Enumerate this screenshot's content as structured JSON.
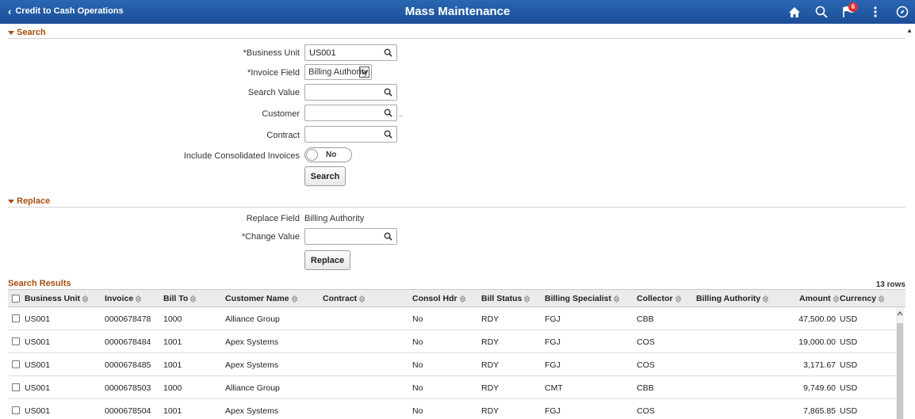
{
  "banner": {
    "back_label": "Credit to Cash Operations",
    "title": "Mass Maintenance",
    "notification_count": "6",
    "icons": [
      "home-icon",
      "search-icon",
      "flag-icon",
      "actions-menu-icon",
      "navbar-icon"
    ]
  },
  "search_section": {
    "title": "Search",
    "business_unit": {
      "label": "*Business Unit",
      "value": "US001"
    },
    "invoice_field": {
      "label": "*Invoice Field",
      "value": "Billing Authority"
    },
    "search_value": {
      "label": "Search Value",
      "value": ""
    },
    "customer": {
      "label": "Customer",
      "value": "",
      "more": ".."
    },
    "contract": {
      "label": "Contract",
      "value": ""
    },
    "include_consolidated": {
      "label": "Include Consolidated Invoices",
      "value": "No"
    },
    "search_button": "Search"
  },
  "replace_section": {
    "title": "Replace",
    "replace_field": {
      "label": "Replace Field",
      "value": "Billing Authority"
    },
    "change_value": {
      "label": "*Change Value",
      "value": ""
    },
    "replace_button": "Replace"
  },
  "results": {
    "title": "Search Results",
    "row_count": "13 rows",
    "columns": [
      "Business Unit",
      "Invoice",
      "Bill To",
      "Customer Name",
      "Contract",
      "Consol Hdr",
      "Bill Status",
      "Billing Specialist",
      "Collector",
      "Billing Authority",
      "Amount",
      "Currency"
    ],
    "rows": [
      {
        "business_unit": "US001",
        "invoice": "0000678478",
        "bill_to": "1000",
        "customer_name": "Alliance Group",
        "contract": "",
        "consol_hdr": "No",
        "bill_status": "RDY",
        "billing_specialist": "FGJ",
        "collector": "CBB",
        "billing_authority": "",
        "amount": "47,500.00",
        "currency": "USD"
      },
      {
        "business_unit": "US001",
        "invoice": "0000678484",
        "bill_to": "1001",
        "customer_name": "Apex Systems",
        "contract": "",
        "consol_hdr": "No",
        "bill_status": "RDY",
        "billing_specialist": "FGJ",
        "collector": "COS",
        "billing_authority": "",
        "amount": "19,000.00",
        "currency": "USD"
      },
      {
        "business_unit": "US001",
        "invoice": "0000678485",
        "bill_to": "1001",
        "customer_name": "Apex Systems",
        "contract": "",
        "consol_hdr": "No",
        "bill_status": "RDY",
        "billing_specialist": "FGJ",
        "collector": "COS",
        "billing_authority": "",
        "amount": "3,171.67",
        "currency": "USD"
      },
      {
        "business_unit": "US001",
        "invoice": "0000678503",
        "bill_to": "1000",
        "customer_name": "Alliance Group",
        "contract": "",
        "consol_hdr": "No",
        "bill_status": "RDY",
        "billing_specialist": "CMT",
        "collector": "CBB",
        "billing_authority": "",
        "amount": "9,749.60",
        "currency": "USD"
      },
      {
        "business_unit": "US001",
        "invoice": "0000678504",
        "bill_to": "1001",
        "customer_name": "Apex Systems",
        "contract": "",
        "consol_hdr": "No",
        "bill_status": "RDY",
        "billing_specialist": "FGJ",
        "collector": "COS",
        "billing_authority": "",
        "amount": "7,865.85",
        "currency": "USD"
      }
    ]
  },
  "colors": {
    "banner": "#1b4f97",
    "section_title": "#a84d10",
    "badge": "#e03030"
  }
}
